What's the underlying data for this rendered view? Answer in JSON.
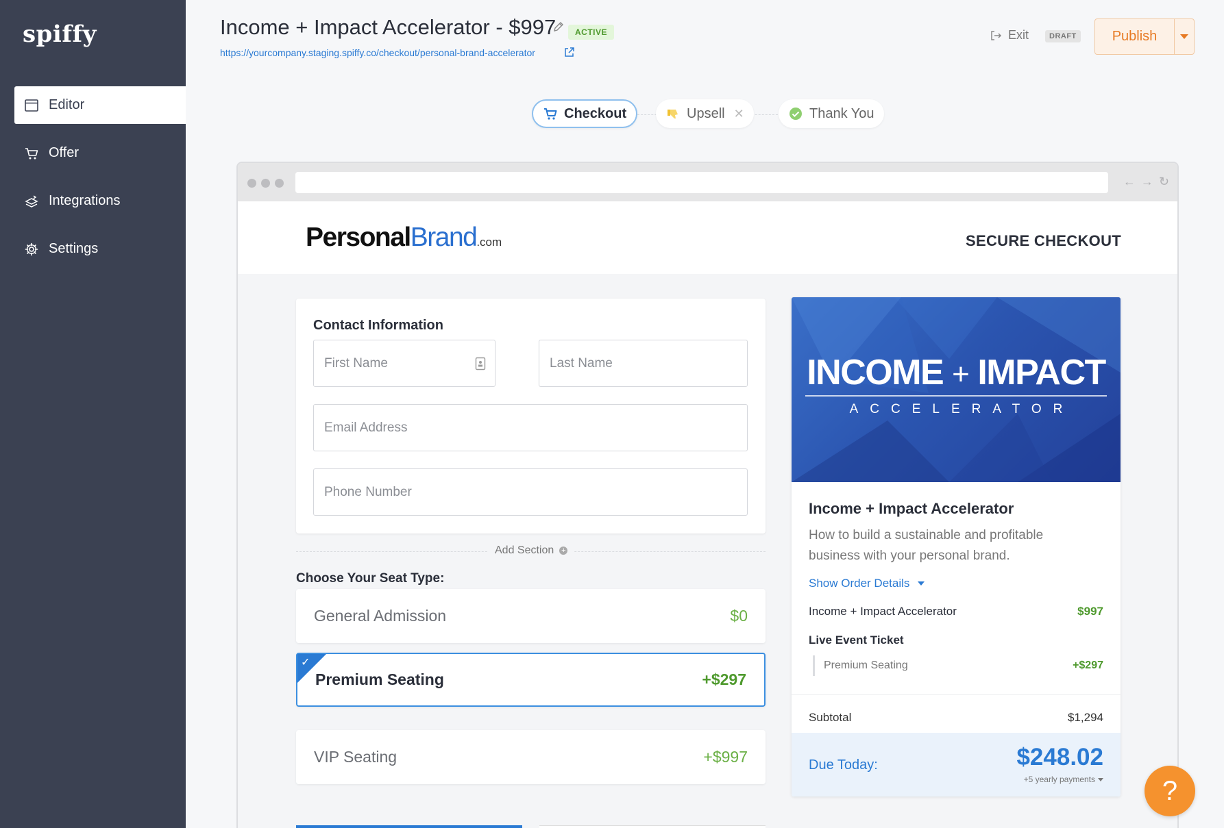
{
  "app": {
    "logo": "spiffy"
  },
  "sidebar": {
    "items": [
      {
        "label": "Editor",
        "icon": "window-icon",
        "active": true
      },
      {
        "label": "Offer",
        "icon": "cart-icon",
        "active": false
      },
      {
        "label": "Integrations",
        "icon": "integrations-icon",
        "active": false
      },
      {
        "label": "Settings",
        "icon": "gear-icon",
        "active": false
      }
    ]
  },
  "header": {
    "title": "Income + Impact Accelerator - $997",
    "status": "ACTIVE",
    "url": "https://yourcompany.staging.spiffy.co/checkout/personal-brand-accelerator",
    "exit_label": "Exit",
    "draft_badge": "DRAFT",
    "publish_label": "Publish"
  },
  "steps": [
    {
      "label": "Checkout",
      "icon": "cart-icon",
      "active": true
    },
    {
      "label": "Upsell",
      "icon": "thumbs-down-icon",
      "active": false
    },
    {
      "label": "Thank You",
      "icon": "check-circle-icon",
      "active": false
    }
  ],
  "checkout": {
    "brand": {
      "part1": "Personal",
      "part2": "Brand",
      "part3": ".com"
    },
    "secure_label": "SECURE CHECKOUT",
    "contact": {
      "heading": "Contact Information",
      "first_name": "First Name",
      "last_name": "Last Name",
      "email": "Email Address",
      "phone": "Phone Number"
    },
    "add_section": "Add Section",
    "seat_heading": "Choose Your Seat Type:",
    "seats": [
      {
        "label": "General Admission",
        "price": "$0",
        "selected": false
      },
      {
        "label": "Premium Seating",
        "price": "+$297",
        "selected": true
      },
      {
        "label": "VIP Seating",
        "price": "+$997",
        "selected": false
      }
    ]
  },
  "product": {
    "banner_word1": "INCOME",
    "banner_plus": "+",
    "banner_word2": "IMPACT",
    "banner_sub": "ACCELERATOR",
    "title": "Income + Impact Accelerator",
    "description": "How to build a sustainable and profitable business with your personal brand.",
    "show_details": "Show Order Details",
    "line_items": [
      {
        "label": "Income + Impact Accelerator",
        "price": "$997"
      },
      {
        "label": "Live Event Ticket",
        "price": ""
      }
    ],
    "sub_item": {
      "label": "Premium Seating",
      "price": "+$297"
    },
    "subtotal_label": "Subtotal",
    "subtotal_value": "$1,294",
    "due_label": "Due Today:",
    "due_amount": "$248.02",
    "payments_note": "+5 yearly payments"
  },
  "help": {
    "label": "?"
  },
  "colors": {
    "sidebar_bg": "#3b4152",
    "accent_blue": "#2a7ad3",
    "publish_orange": "#e77a24",
    "price_green": "#4f9a2e",
    "help_orange": "#f5922e"
  }
}
